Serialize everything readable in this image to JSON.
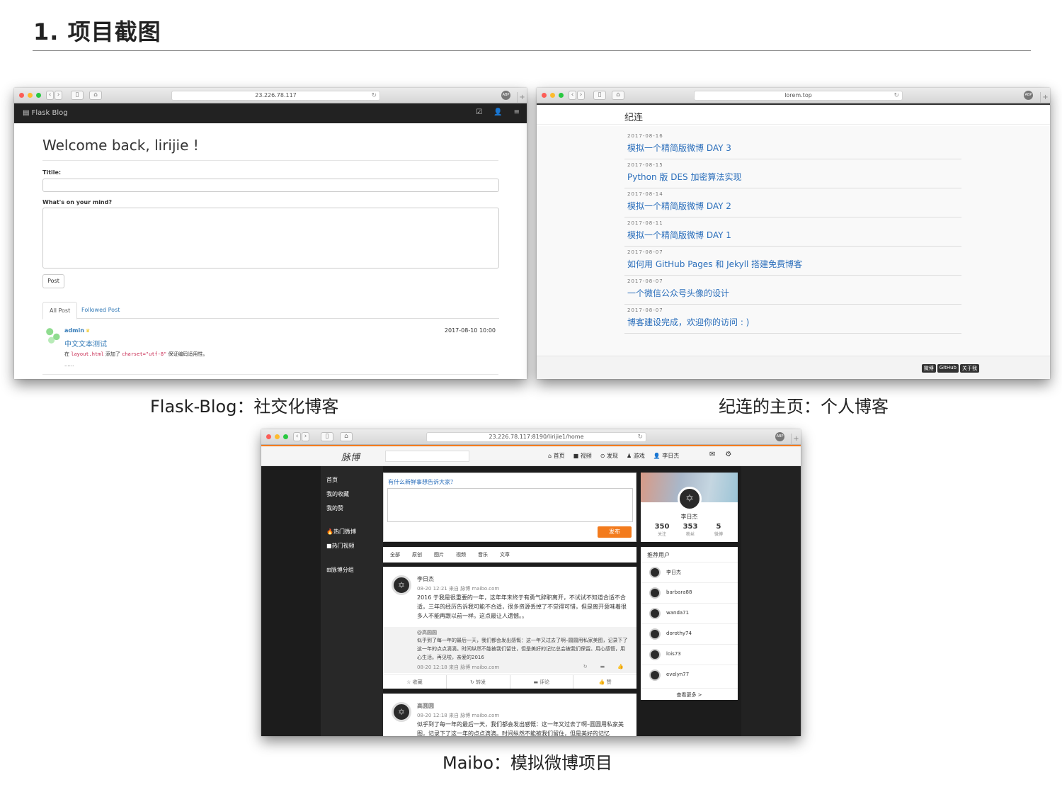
{
  "heading": "1. 项目截图",
  "captions": {
    "flask": "Flask-Blog：社交化博客",
    "lorem": "纪连的主页：个人博客",
    "maibo": "Maibo：模拟微博项目"
  },
  "flask": {
    "url": "23.226.78.117",
    "brand": "Flask Blog",
    "welcome": "Welcome back, lirijie !",
    "title_label": "Titile:",
    "body_label": "What's on your mind?",
    "post_button": "Post",
    "tabs": [
      "All Post",
      "Followed Post"
    ],
    "post": {
      "author": "admin",
      "date": "2017-08-10 10:00",
      "title": "中文文本测试",
      "body_prefix": "在",
      "code1": "layout.html",
      "body_mid": "添加了",
      "code2": "charset=\"utf-8\"",
      "body_suffix": "保证编码适用性。",
      "ellipsis": "......"
    }
  },
  "lorem": {
    "url": "lorem.top",
    "brand": "纪连",
    "posts": [
      {
        "date": "2017-08-16",
        "title": "模拟一个精简版微博 DAY 3"
      },
      {
        "date": "2017-08-15",
        "title": "Python 版 DES 加密算法实现"
      },
      {
        "date": "2017-08-14",
        "title": "模拟一个精简版微博 DAY 2"
      },
      {
        "date": "2017-08-11",
        "title": "模拟一个精简版微博 DAY 1"
      },
      {
        "date": "2017-08-07",
        "title": "如何用 GitHub Pages 和 Jekyll 搭建免费博客"
      },
      {
        "date": "2017-08-07",
        "title": "一个微信公众号头像的设计"
      },
      {
        "date": "2017-08-07",
        "title": "博客建设完成，欢迎你的访问 : )"
      }
    ],
    "badges": [
      "微博",
      "GitHub",
      "关于我"
    ]
  },
  "maibo": {
    "url": "23.226.78.117:8190/lirijie1/home",
    "logo": "脉博",
    "nav": [
      "首页",
      "视频",
      "发现",
      "游戏",
      "李日杰"
    ],
    "side": [
      "首页",
      "我的收藏",
      "我的赞",
      "热门微博",
      "热门视频",
      "脉博分组"
    ],
    "compose_prompt": "有什么新鲜事想告诉大家？",
    "publish": "发布",
    "filters": [
      "全部",
      "原创",
      "图片",
      "视频",
      "音乐",
      "文章"
    ],
    "post1": {
      "name": "李日杰",
      "meta": "08-20 12:21 来自 脉博 maibo.com",
      "text": "2016 于我是很重要的一年，这年年末终于有勇气辞职离开，不试试不知道合适不合适，三年的经历告诉我可能不合适，很多资源丢掉了不觉得可惜，但是离开意味着很多人不能再跟以前一样。这点最让人遗憾。。",
      "repost_name": "@高圆圆",
      "repost_text": "似乎到了每一年的最后一天，我们都会发出感慨：这一年又过去了啊–圆圆用私家美图，记录下了这一年的点点滴滴。时间纵然不能被我们留住，但是美好的记忆总会被我们保留。用心感悟，用心生活。再见啦，亲爱的2016",
      "repost_meta": "08-20 12:18 来自 脉博 maibo.com"
    },
    "actions": [
      "收藏",
      "转发",
      "评论",
      "赞"
    ],
    "post2": {
      "name": "高圆圆",
      "meta": "08-20 12:18 来自 脉博 maibo.com",
      "text": "似乎到了每一年的最后一天，我们都会发出感慨：这一年又过去了啊–圆圆用私家美图，记录下了这一年的点点滴滴。时间纵然不能被我们留住，但是美好的记忆"
    },
    "profile": {
      "name": "李日杰",
      "stats": [
        {
          "n": "350",
          "l": "关注"
        },
        {
          "n": "353",
          "l": "粉丝"
        },
        {
          "n": "5",
          "l": "微博"
        }
      ]
    },
    "rec_title": "推荐用户",
    "rec_users": [
      "李日杰",
      "barbara88",
      "wanda71",
      "dorothy74",
      "lois73",
      "evelyn77"
    ],
    "rec_more": "查看更多 >"
  }
}
